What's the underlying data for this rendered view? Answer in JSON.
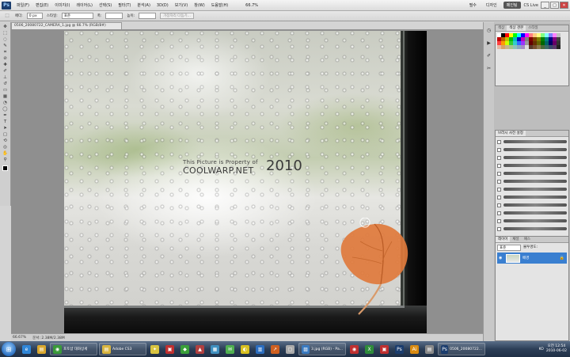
{
  "menubar": {
    "logo": "Ps",
    "items": [
      "파일(F)",
      "편집(E)",
      "이미지(I)",
      "레이어(L)",
      "선택(S)",
      "필터(T)",
      "분석(A)",
      "3D(D)",
      "보기(V)",
      "창(W)",
      "도움말(H)"
    ],
    "zoom": "66.7%",
    "workspaces": [
      "필수",
      "디자인",
      "페인팅"
    ],
    "active_workspace": "필수",
    "cs_live": "CS Live",
    "win_controls": [
      "_",
      "□",
      "✕"
    ]
  },
  "options": {
    "feather_label": "페더:",
    "feather_value": "0 px",
    "style_label": "스타일:",
    "style_value": "표준",
    "width_label": "폭:",
    "height_label": "높이:",
    "refine_edge": "가장자리 다듬기..."
  },
  "document": {
    "tab_title": "0506_20080722_CAMERA_1.jpg @ 66.7% (RGB/8#)",
    "watermark_line1": "This Picture is Property of",
    "watermark_line2": "COOLWARP.NET",
    "watermark_year": "2010"
  },
  "status": {
    "zoom": "66.67%",
    "doc_size": "문서: 2.38M/2.38M"
  },
  "panels": {
    "color_tabs": [
      "색상",
      "색상 견본",
      "스타일"
    ],
    "brush_tabs": [
      "브러시 사전 설정"
    ],
    "layer_tabs": [
      "레이어",
      "채널",
      "패스"
    ],
    "layer_mode": "표준",
    "layer_opacity": "불투명도:",
    "layer_name": "배경",
    "swatch_colors": [
      "#ffffff",
      "#000000",
      "#ff0000",
      "#ffff00",
      "#00ff00",
      "#00ffff",
      "#0000ff",
      "#ff00ff",
      "#ff8080",
      "#ffcc80",
      "#ffff80",
      "#80ff80",
      "#80ffff",
      "#8080ff",
      "#ff80ff",
      "#c0c0c0",
      "#c00000",
      "#c06000",
      "#c0c000",
      "#00c000",
      "#00c0c0",
      "#0000c0",
      "#c000c0",
      "#808080",
      "#800000",
      "#804000",
      "#808000",
      "#008000",
      "#008080",
      "#000080",
      "#800080",
      "#404040",
      "#ff4040",
      "#ff9900",
      "#ccff00",
      "#33cc33",
      "#33cccc",
      "#3366ff",
      "#9933ff",
      "#999999",
      "#660000",
      "#663300",
      "#666600",
      "#006600",
      "#006666",
      "#000066",
      "#660066",
      "#333333",
      "#e6b8a2",
      "#d9a066",
      "#c8b48a",
      "#a6c48a",
      "#8ac4b8",
      "#8aa6c4",
      "#a68ac4",
      "#dddddd",
      "#5a3d2b",
      "#7a5230",
      "#8c7a4a",
      "#4a6b3a",
      "#3a6b66",
      "#3a4a6b",
      "#5a3a6b",
      "#222222"
    ]
  },
  "taskbar": {
    "items": [
      {
        "label": "",
        "icon": "ie-icon",
        "color": "#2f86d8",
        "glyph": "e"
      },
      {
        "label": "",
        "icon": "folder-icon",
        "color": "#d9a830",
        "glyph": "▤"
      },
      {
        "label": "포토샵 대화상세",
        "icon": "chrome-icon",
        "color": "#3a9a3a",
        "glyph": "◉",
        "wide": true
      },
      {
        "label": "Adobe CS3",
        "icon": "folder-icon",
        "color": "#d9b540",
        "glyph": "▤",
        "wide": true
      },
      {
        "label": "",
        "icon": "app-icon",
        "color": "#d9c440",
        "glyph": "✦"
      },
      {
        "label": "",
        "icon": "app-icon",
        "color": "#c03030",
        "glyph": "▣"
      },
      {
        "label": "",
        "icon": "app-icon",
        "color": "#3aa03a",
        "glyph": "◆"
      },
      {
        "label": "",
        "icon": "app-icon",
        "color": "#b04040",
        "glyph": "▲"
      },
      {
        "label": "",
        "icon": "app-icon",
        "color": "#4090c0",
        "glyph": "▦"
      },
      {
        "label": "",
        "icon": "app-icon",
        "color": "#50b050",
        "glyph": "✉"
      },
      {
        "label": "",
        "icon": "app-icon",
        "color": "#d8c020",
        "glyph": "◐"
      },
      {
        "label": "",
        "icon": "app-icon",
        "color": "#2c6ec0",
        "glyph": "▥"
      },
      {
        "label": "",
        "icon": "app-icon",
        "color": "#d06020",
        "glyph": "↗"
      },
      {
        "label": "",
        "icon": "app-icon",
        "color": "#aaaaaa",
        "glyph": "▢"
      },
      {
        "label": "3.jpg (RGB) - Pa...",
        "icon": "paint-icon",
        "color": "#3a7ac0",
        "glyph": "▨",
        "wide": true
      },
      {
        "label": "",
        "icon": "app-icon",
        "color": "#c03030",
        "glyph": "◉"
      },
      {
        "label": "",
        "icon": "excel-icon",
        "color": "#2e8b3a",
        "glyph": "X"
      },
      {
        "label": "",
        "icon": "app-icon",
        "color": "#c03030",
        "glyph": "▣"
      },
      {
        "label": "",
        "icon": "photoshop-icon",
        "color": "#1b3d6e",
        "glyph": "Ps"
      },
      {
        "label": "",
        "icon": "illustrator-icon",
        "color": "#d98a10",
        "glyph": "Ai"
      },
      {
        "label": "",
        "icon": "app-icon",
        "color": "#8a8a8a",
        "glyph": "▤"
      },
      {
        "label": "0506_20080722...",
        "icon": "photoshop-icon",
        "color": "#1b3d6e",
        "glyph": "Ps",
        "wide": true
      }
    ],
    "tray_lang": "KO",
    "time": "오전 12:54",
    "date": "2010-06-02"
  }
}
